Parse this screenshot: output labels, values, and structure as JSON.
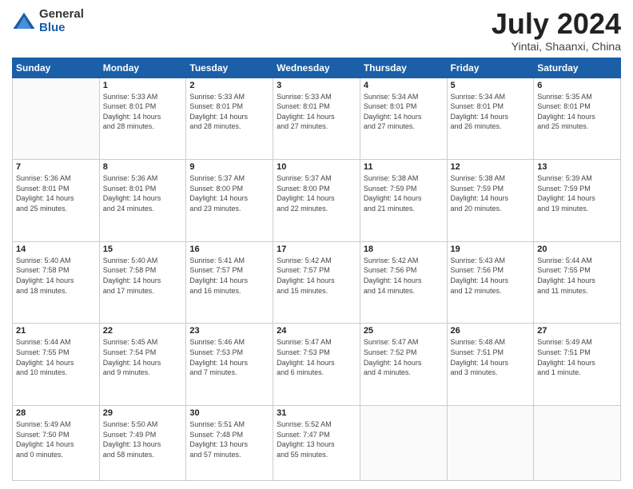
{
  "logo": {
    "general": "General",
    "blue": "Blue"
  },
  "title": "July 2024",
  "location": "Yintai, Shaanxi, China",
  "days_header": [
    "Sunday",
    "Monday",
    "Tuesday",
    "Wednesday",
    "Thursday",
    "Friday",
    "Saturday"
  ],
  "weeks": [
    [
      {
        "day": "",
        "info": ""
      },
      {
        "day": "1",
        "info": "Sunrise: 5:33 AM\nSunset: 8:01 PM\nDaylight: 14 hours\nand 28 minutes."
      },
      {
        "day": "2",
        "info": "Sunrise: 5:33 AM\nSunset: 8:01 PM\nDaylight: 14 hours\nand 28 minutes."
      },
      {
        "day": "3",
        "info": "Sunrise: 5:33 AM\nSunset: 8:01 PM\nDaylight: 14 hours\nand 27 minutes."
      },
      {
        "day": "4",
        "info": "Sunrise: 5:34 AM\nSunset: 8:01 PM\nDaylight: 14 hours\nand 27 minutes."
      },
      {
        "day": "5",
        "info": "Sunrise: 5:34 AM\nSunset: 8:01 PM\nDaylight: 14 hours\nand 26 minutes."
      },
      {
        "day": "6",
        "info": "Sunrise: 5:35 AM\nSunset: 8:01 PM\nDaylight: 14 hours\nand 25 minutes."
      }
    ],
    [
      {
        "day": "7",
        "info": "Sunrise: 5:36 AM\nSunset: 8:01 PM\nDaylight: 14 hours\nand 25 minutes."
      },
      {
        "day": "8",
        "info": "Sunrise: 5:36 AM\nSunset: 8:01 PM\nDaylight: 14 hours\nand 24 minutes."
      },
      {
        "day": "9",
        "info": "Sunrise: 5:37 AM\nSunset: 8:00 PM\nDaylight: 14 hours\nand 23 minutes."
      },
      {
        "day": "10",
        "info": "Sunrise: 5:37 AM\nSunset: 8:00 PM\nDaylight: 14 hours\nand 22 minutes."
      },
      {
        "day": "11",
        "info": "Sunrise: 5:38 AM\nSunset: 7:59 PM\nDaylight: 14 hours\nand 21 minutes."
      },
      {
        "day": "12",
        "info": "Sunrise: 5:38 AM\nSunset: 7:59 PM\nDaylight: 14 hours\nand 20 minutes."
      },
      {
        "day": "13",
        "info": "Sunrise: 5:39 AM\nSunset: 7:59 PM\nDaylight: 14 hours\nand 19 minutes."
      }
    ],
    [
      {
        "day": "14",
        "info": "Sunrise: 5:40 AM\nSunset: 7:58 PM\nDaylight: 14 hours\nand 18 minutes."
      },
      {
        "day": "15",
        "info": "Sunrise: 5:40 AM\nSunset: 7:58 PM\nDaylight: 14 hours\nand 17 minutes."
      },
      {
        "day": "16",
        "info": "Sunrise: 5:41 AM\nSunset: 7:57 PM\nDaylight: 14 hours\nand 16 minutes."
      },
      {
        "day": "17",
        "info": "Sunrise: 5:42 AM\nSunset: 7:57 PM\nDaylight: 14 hours\nand 15 minutes."
      },
      {
        "day": "18",
        "info": "Sunrise: 5:42 AM\nSunset: 7:56 PM\nDaylight: 14 hours\nand 14 minutes."
      },
      {
        "day": "19",
        "info": "Sunrise: 5:43 AM\nSunset: 7:56 PM\nDaylight: 14 hours\nand 12 minutes."
      },
      {
        "day": "20",
        "info": "Sunrise: 5:44 AM\nSunset: 7:55 PM\nDaylight: 14 hours\nand 11 minutes."
      }
    ],
    [
      {
        "day": "21",
        "info": "Sunrise: 5:44 AM\nSunset: 7:55 PM\nDaylight: 14 hours\nand 10 minutes."
      },
      {
        "day": "22",
        "info": "Sunrise: 5:45 AM\nSunset: 7:54 PM\nDaylight: 14 hours\nand 9 minutes."
      },
      {
        "day": "23",
        "info": "Sunrise: 5:46 AM\nSunset: 7:53 PM\nDaylight: 14 hours\nand 7 minutes."
      },
      {
        "day": "24",
        "info": "Sunrise: 5:47 AM\nSunset: 7:53 PM\nDaylight: 14 hours\nand 6 minutes."
      },
      {
        "day": "25",
        "info": "Sunrise: 5:47 AM\nSunset: 7:52 PM\nDaylight: 14 hours\nand 4 minutes."
      },
      {
        "day": "26",
        "info": "Sunrise: 5:48 AM\nSunset: 7:51 PM\nDaylight: 14 hours\nand 3 minutes."
      },
      {
        "day": "27",
        "info": "Sunrise: 5:49 AM\nSunset: 7:51 PM\nDaylight: 14 hours\nand 1 minute."
      }
    ],
    [
      {
        "day": "28",
        "info": "Sunrise: 5:49 AM\nSunset: 7:50 PM\nDaylight: 14 hours\nand 0 minutes."
      },
      {
        "day": "29",
        "info": "Sunrise: 5:50 AM\nSunset: 7:49 PM\nDaylight: 13 hours\nand 58 minutes."
      },
      {
        "day": "30",
        "info": "Sunrise: 5:51 AM\nSunset: 7:48 PM\nDaylight: 13 hours\nand 57 minutes."
      },
      {
        "day": "31",
        "info": "Sunrise: 5:52 AM\nSunset: 7:47 PM\nDaylight: 13 hours\nand 55 minutes."
      },
      {
        "day": "",
        "info": ""
      },
      {
        "day": "",
        "info": ""
      },
      {
        "day": "",
        "info": ""
      }
    ]
  ]
}
